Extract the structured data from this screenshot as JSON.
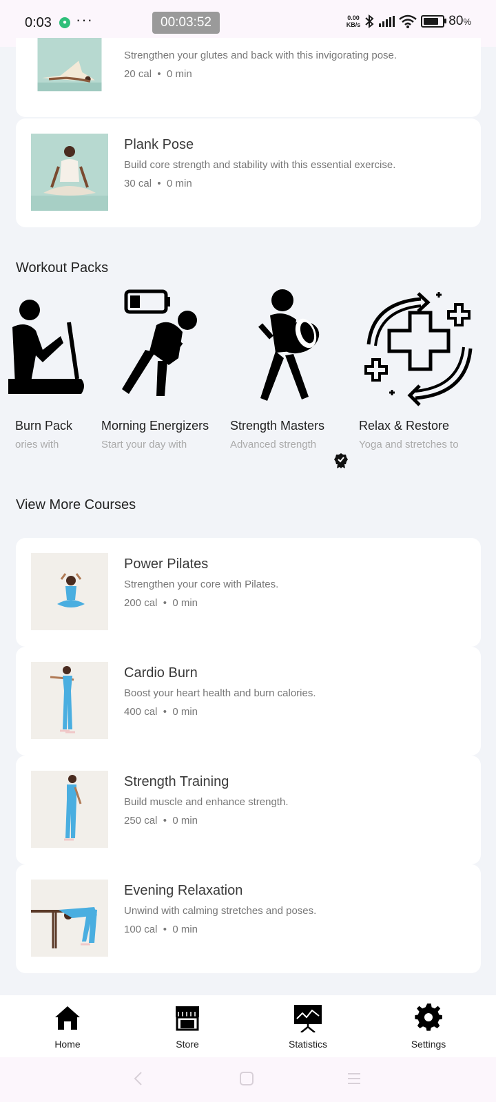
{
  "status_bar": {
    "time": "0:03",
    "timer": "00:03:52",
    "net_speed_value": "0.00",
    "net_speed_unit": "KB/s",
    "battery_percent": "80",
    "battery_unit": "%",
    "battery_level": 0.8
  },
  "top_cards": [
    {
      "desc": "Strengthen your glutes and back with this invigorating pose.",
      "cal": "20 cal",
      "min": "0 min",
      "sep": "•"
    },
    {
      "title": "Plank Pose",
      "desc": "Build core strength and stability with this essential exercise.",
      "cal": "30 cal",
      "min": "0 min",
      "sep": "•"
    }
  ],
  "workout_packs": {
    "title": "Workout Packs",
    "items": [
      {
        "name": "Burn Pack",
        "desc": "ories with",
        "icon": "treadmill-runner-icon"
      },
      {
        "name": "Morning Energizers",
        "desc": "Start your day with",
        "icon": "low-battery-tired-person-icon"
      },
      {
        "name": "Strength Masters",
        "desc": "Advanced strength",
        "icon": "weightlifter-icon"
      },
      {
        "name": "Relax & Restore",
        "desc": "Yoga and stretches to",
        "icon": "health-cross-cycle-icon"
      }
    ]
  },
  "more_courses": {
    "title": "View More Courses",
    "items": [
      {
        "title": "Power Pilates",
        "desc": "Strengthen your core with Pilates.",
        "cal": "200 cal",
        "min": "0 min",
        "sep": "•"
      },
      {
        "title": "Cardio Burn",
        "desc": "Boost your heart health and burn calories.",
        "cal": "400 cal",
        "min": "0 min",
        "sep": "•"
      },
      {
        "title": "Strength Training",
        "desc": "Build muscle and enhance strength.",
        "cal": "250 cal",
        "min": "0 min",
        "sep": "•"
      },
      {
        "title": "Evening Relaxation",
        "desc": "Unwind with calming stretches and poses.",
        "cal": "100 cal",
        "min": "0 min",
        "sep": "•"
      }
    ]
  },
  "bottom_nav": [
    {
      "label": "Home",
      "icon": "home-icon"
    },
    {
      "label": "Store",
      "icon": "store-icon"
    },
    {
      "label": "Statistics",
      "icon": "statistics-board-icon"
    },
    {
      "label": "Settings",
      "icon": "gear-icon"
    }
  ],
  "colors": {
    "background": "#f2f4f8",
    "card": "#ffffff",
    "status_bar": "#fcf6fc",
    "thumb_teal": "#b7d9d0",
    "thumb_beige": "#f2efea",
    "outfit_blue": "#4aaee0"
  }
}
